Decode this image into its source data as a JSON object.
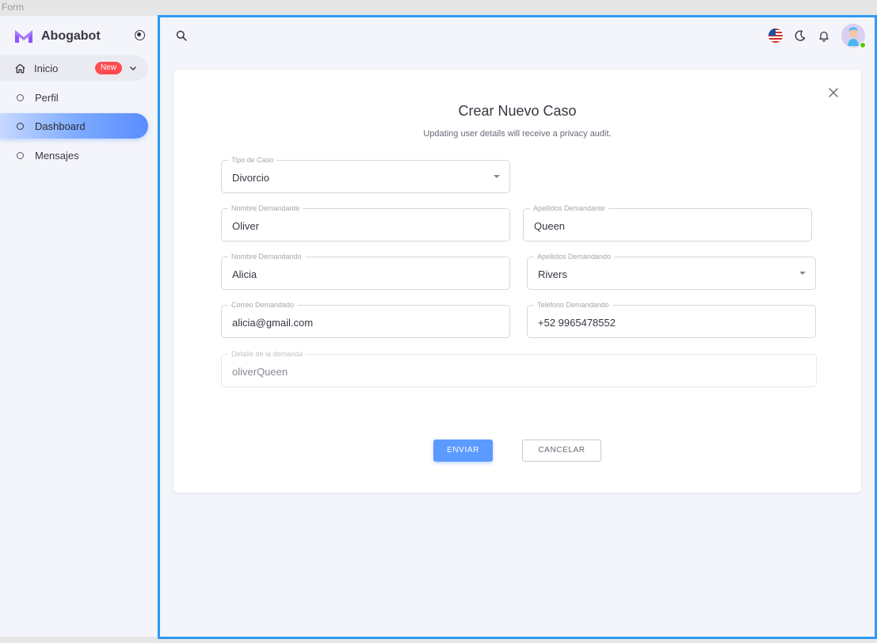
{
  "window": {
    "title": "Form"
  },
  "sidebar": {
    "brand": "Abogabot",
    "items": [
      {
        "label": "Inicio",
        "badge": "New",
        "icon": "home-icon",
        "expanded": true
      },
      {
        "label": "Perfil",
        "icon": "circle-icon"
      },
      {
        "label": "Dashboard",
        "icon": "circle-icon",
        "active": true
      },
      {
        "label": "Mensajes",
        "icon": "circle-icon"
      }
    ]
  },
  "header": {
    "icons": [
      "search-icon",
      "us-flag-icon",
      "moon-icon",
      "bell-icon",
      "avatar"
    ]
  },
  "form": {
    "title": "Crear Nuevo Caso",
    "subtitle": "Updating user details will receive a privacy audit.",
    "fields": {
      "tipo_caso": {
        "label": "Tipo de Caso",
        "value": "Divorcio"
      },
      "nombre_demandante": {
        "label": "Nombre Demandante",
        "value": "Oliver"
      },
      "apellidos_demandante": {
        "label": "Apellidos Demandante",
        "value": "Queen"
      },
      "nombre_demandando": {
        "label": "Nombre Demandando",
        "value": "Alicia"
      },
      "apellidos_demandando": {
        "label": "Apellidos Demandando",
        "value": "Rivers"
      },
      "correo_demandado": {
        "label": "Correo Demandado",
        "value": "alicia@gmail.com"
      },
      "telefono_demandando": {
        "label": "Telefono Demandando",
        "value": "+52 9965478552"
      },
      "detalle": {
        "label": "Detalle de la demanda",
        "value": "oliverQueen"
      }
    },
    "submit_label": "ENVIAR",
    "cancel_label": "CANCELAR"
  },
  "colors": {
    "accent": "#5b9bff",
    "badge": "#ff4c51",
    "frame_border": "#2f9af2",
    "online": "#56ca00"
  }
}
